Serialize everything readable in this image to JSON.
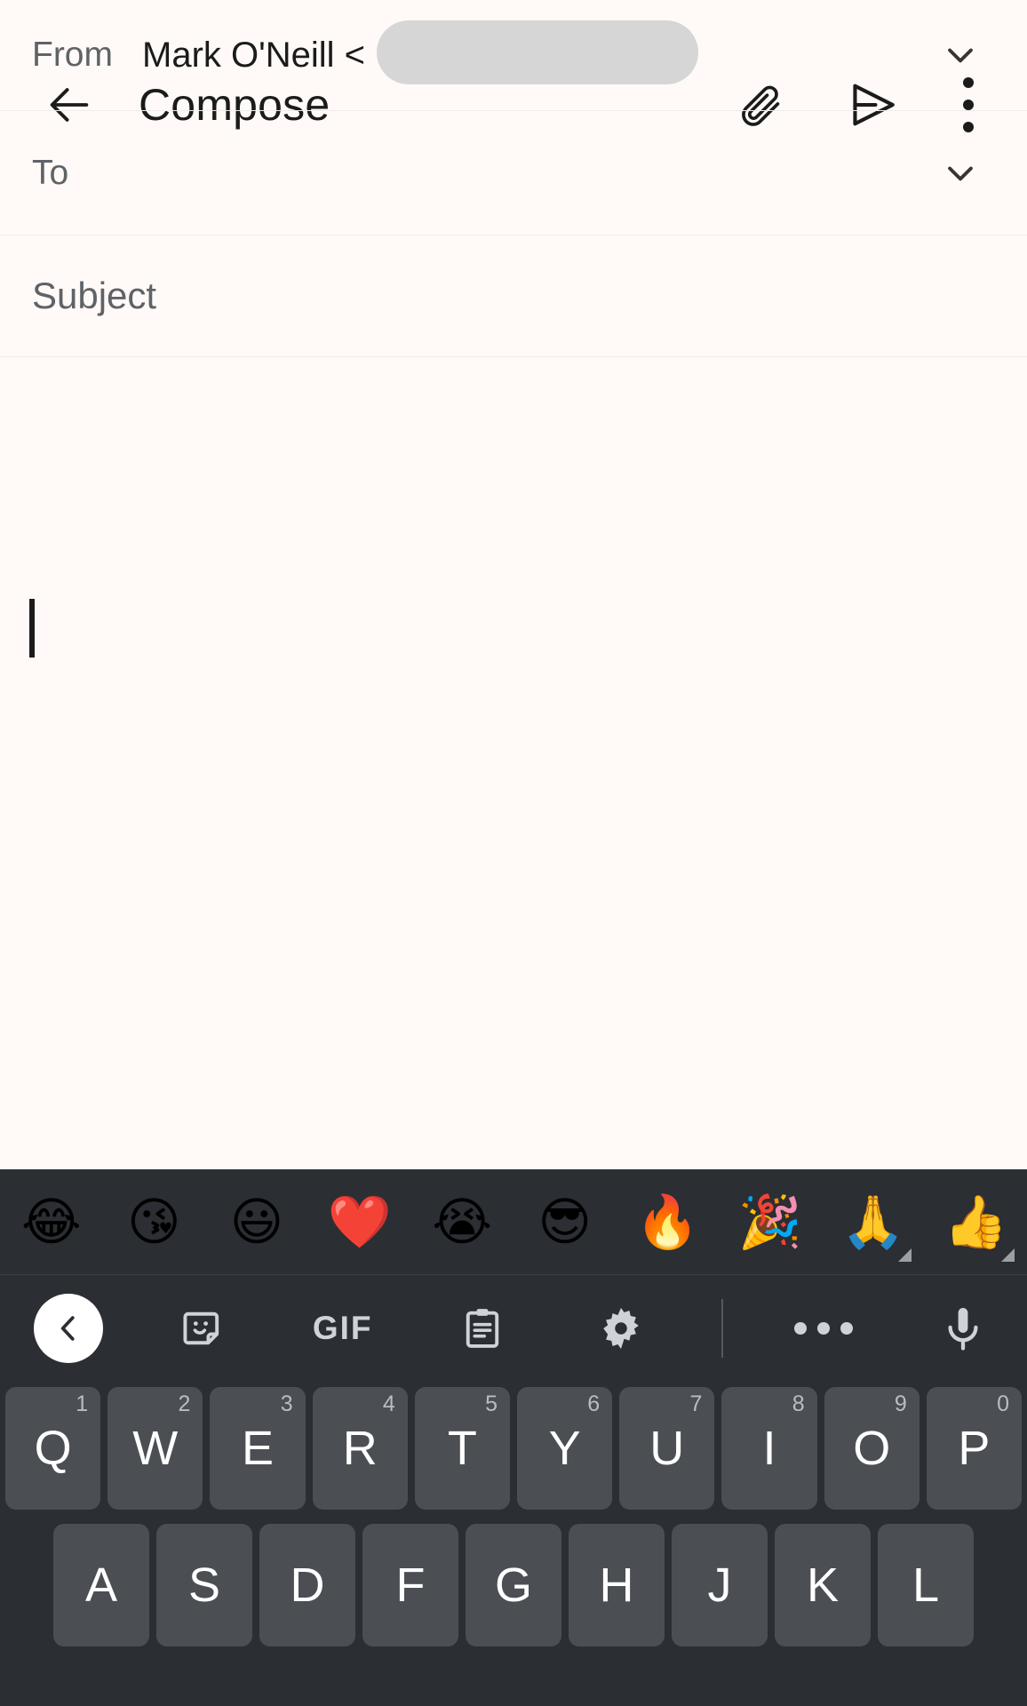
{
  "app": {
    "title": "Compose",
    "actions": {
      "back": "back-arrow",
      "attach": "paperclip",
      "send": "send-arrow",
      "more": "more-vertical"
    }
  },
  "fields": {
    "from": {
      "label": "From",
      "value": "Mark O'Neill  <",
      "redacted": true,
      "expand_icon": "chevron-down"
    },
    "to": {
      "label": "To",
      "value": "",
      "expand_icon": "chevron-down"
    },
    "subject": {
      "placeholder": "Subject",
      "value": ""
    },
    "body": {
      "placeholder": "",
      "value": ""
    }
  },
  "keyboard": {
    "emoji_row": [
      {
        "glyph": "😂",
        "name": "face-with-tears-of-joy",
        "variant": false
      },
      {
        "glyph": "😘",
        "name": "face-blowing-a-kiss",
        "variant": false
      },
      {
        "glyph": "😃",
        "name": "grinning-face-with-big-eyes",
        "variant": false
      },
      {
        "glyph": "❤️",
        "name": "red-heart",
        "variant": false
      },
      {
        "glyph": "😭",
        "name": "loudly-crying-face",
        "variant": false
      },
      {
        "glyph": "😎",
        "name": "smiling-face-with-sunglasses",
        "variant": false
      },
      {
        "glyph": "🔥",
        "name": "fire",
        "variant": false
      },
      {
        "glyph": "🎉",
        "name": "party-popper",
        "variant": false
      },
      {
        "glyph": "🙏",
        "name": "folded-hands",
        "variant": true
      },
      {
        "glyph": "👍",
        "name": "thumbs-up",
        "variant": true
      }
    ],
    "toolbar": {
      "back": "chevron-left",
      "sticker": "sticker",
      "gif_label": "GIF",
      "clipboard": "clipboard",
      "settings": "gear",
      "more": "more-horizontal",
      "mic": "microphone"
    },
    "rows": [
      [
        {
          "key": "Q",
          "num": "1"
        },
        {
          "key": "W",
          "num": "2"
        },
        {
          "key": "E",
          "num": "3"
        },
        {
          "key": "R",
          "num": "4"
        },
        {
          "key": "T",
          "num": "5"
        },
        {
          "key": "Y",
          "num": "6"
        },
        {
          "key": "U",
          "num": "7"
        },
        {
          "key": "I",
          "num": "8"
        },
        {
          "key": "O",
          "num": "9"
        },
        {
          "key": "P",
          "num": "0"
        }
      ],
      [
        {
          "key": "A",
          "num": ""
        },
        {
          "key": "S",
          "num": ""
        },
        {
          "key": "D",
          "num": ""
        },
        {
          "key": "F",
          "num": ""
        },
        {
          "key": "G",
          "num": ""
        },
        {
          "key": "H",
          "num": ""
        },
        {
          "key": "J",
          "num": ""
        },
        {
          "key": "K",
          "num": ""
        },
        {
          "key": "L",
          "num": ""
        }
      ]
    ]
  },
  "colors": {
    "app_background": "#fffaf7",
    "keyboard_background": "#2b2e33",
    "key_background": "#4b4f54",
    "redaction": "#d6d6d6",
    "text_primary": "#1b1b1b",
    "text_secondary": "#5f6368"
  }
}
